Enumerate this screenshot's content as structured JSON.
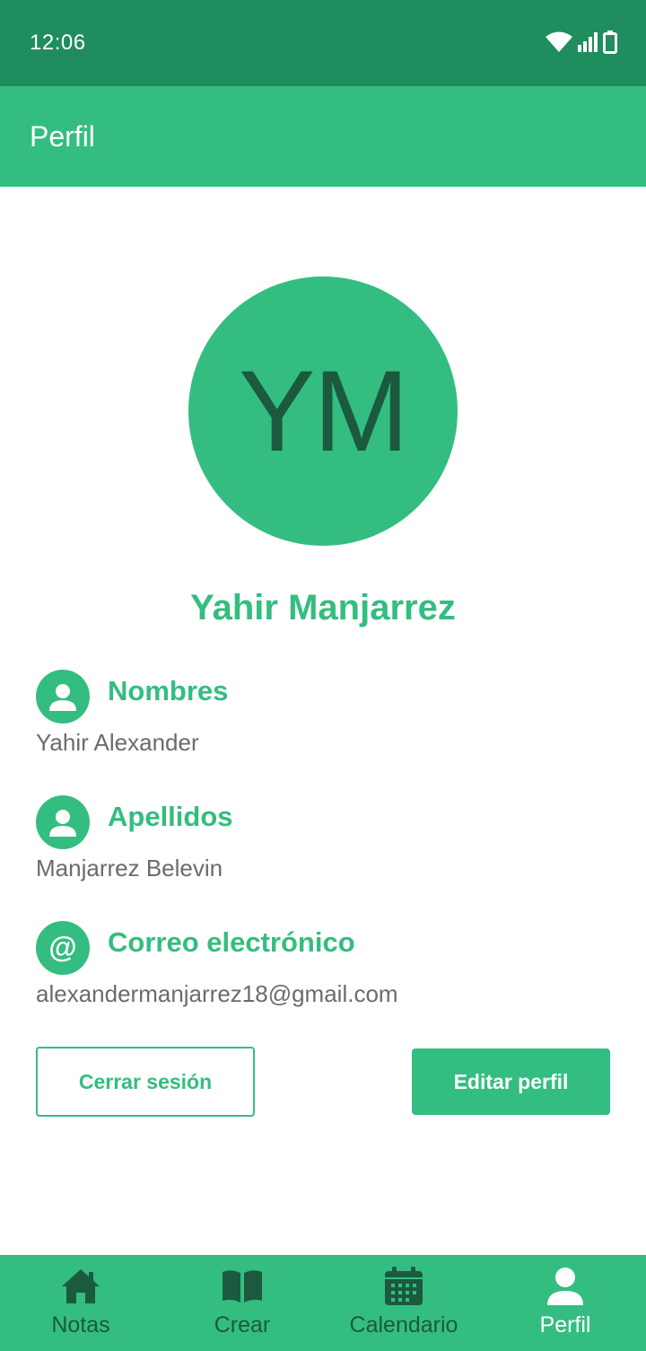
{
  "status_bar": {
    "time": "12:06"
  },
  "app_bar": {
    "title": "Perfil"
  },
  "profile": {
    "initials": "YM",
    "full_name": "Yahir Manjarrez"
  },
  "fields": [
    {
      "label": "Nombres",
      "value": "Yahir Alexander",
      "icon": "person-icon"
    },
    {
      "label": "Apellidos",
      "value": "Manjarrez Belevin",
      "icon": "person-icon"
    },
    {
      "label": "Correo electrónico",
      "value": "alexandermanjarrez18@gmail.com",
      "icon": "at-icon",
      "glyph": "@"
    }
  ],
  "actions": {
    "logout_label": "Cerrar sesión",
    "edit_label": "Editar perfil"
  },
  "bottom_nav": {
    "items": [
      {
        "label": "Notas",
        "icon": "home-icon"
      },
      {
        "label": "Crear",
        "icon": "book-icon"
      },
      {
        "label": "Calendario",
        "icon": "calendar-icon"
      },
      {
        "label": "Perfil",
        "icon": "person-icon",
        "active": true
      }
    ]
  },
  "colors": {
    "status_bar": "#208d5e",
    "accent": "#34bd80",
    "dark_accent": "#1b5a3e",
    "value_text": "#6b6b6b"
  }
}
